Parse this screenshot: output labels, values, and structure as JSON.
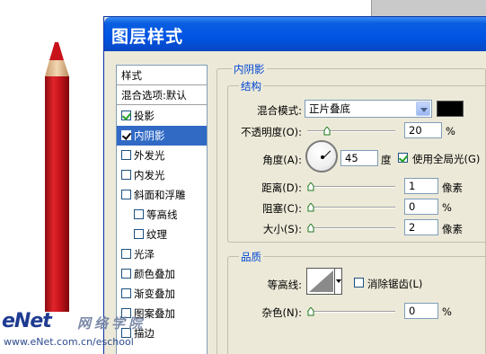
{
  "dialog": {
    "title": "图层样式"
  },
  "style_list": {
    "header": "样式",
    "blend_options": "混合选项:默认",
    "items": [
      {
        "label": "投影",
        "checked": true,
        "sub": false,
        "selected": false
      },
      {
        "label": "内阴影",
        "checked": true,
        "sub": false,
        "selected": true
      },
      {
        "label": "外发光",
        "checked": false,
        "sub": false,
        "selected": false
      },
      {
        "label": "内发光",
        "checked": false,
        "sub": false,
        "selected": false
      },
      {
        "label": "斜面和浮雕",
        "checked": false,
        "sub": false,
        "selected": false
      },
      {
        "label": "等高线",
        "checked": false,
        "sub": true,
        "selected": false
      },
      {
        "label": "纹理",
        "checked": false,
        "sub": true,
        "selected": false
      },
      {
        "label": "光泽",
        "checked": false,
        "sub": false,
        "selected": false
      },
      {
        "label": "颜色叠加",
        "checked": false,
        "sub": false,
        "selected": false
      },
      {
        "label": "渐变叠加",
        "checked": false,
        "sub": false,
        "selected": false
      },
      {
        "label": "图案叠加",
        "checked": false,
        "sub": false,
        "selected": false
      },
      {
        "label": "描边",
        "checked": false,
        "sub": false,
        "selected": false
      }
    ]
  },
  "inner_shadow": {
    "section_title": "内阴影",
    "structure": {
      "title": "结构",
      "blend_mode_label": "混合模式:",
      "blend_mode_value": "正片叠底",
      "color_swatch": "#000000",
      "opacity_label": "不透明度(O):",
      "opacity_value": "20",
      "opacity_fraction": 0.2,
      "opacity_unit": "%",
      "angle_label": "角度(A):",
      "angle_value": "45",
      "angle_unit": "度",
      "global_light_label": "使用全局光(G)",
      "global_light_checked": true,
      "distance_label": "距离(D):",
      "distance_value": "1",
      "distance_unit": "像素",
      "choke_label": "阻塞(C):",
      "choke_value": "0",
      "choke_unit": "%",
      "size_label": "大小(S):",
      "size_value": "2",
      "size_unit": "像素"
    },
    "quality": {
      "title": "品质",
      "contour_label": "等高线:",
      "antialias_label": "消除锯齿(L)",
      "antialias_checked": false,
      "noise_label": "杂色(N):",
      "noise_value": "0",
      "noise_unit": "%"
    }
  },
  "watermark": {
    "logo": "eNet",
    "logo_cn": "网络学院",
    "url": "www.eNet.com.cn/eschool"
  }
}
